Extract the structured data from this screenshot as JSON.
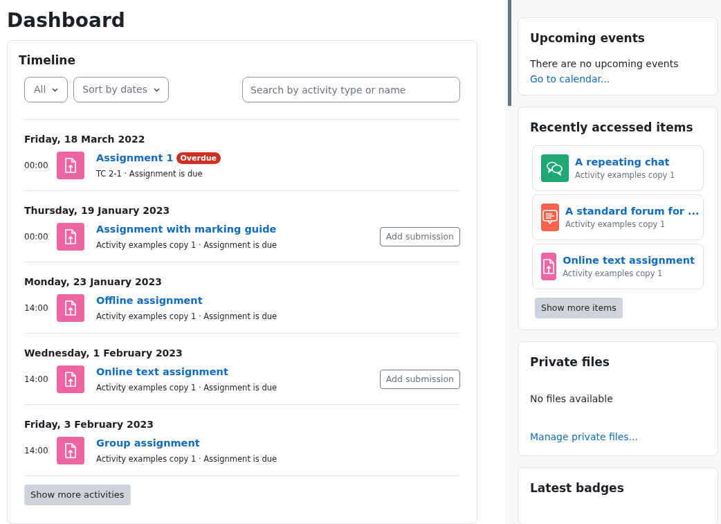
{
  "page_title": "Dashboard",
  "timeline": {
    "title": "Timeline",
    "filter": "All",
    "sort": "Sort by dates",
    "search": {
      "placeholder": "Search by activity type or name"
    },
    "days": [
      {
        "date": "Friday, 18 March 2022",
        "events": [
          {
            "time": "00:00",
            "name": "Assignment 1",
            "badge": "Overdue",
            "details": "TC 2-1 · Assignment is due"
          }
        ]
      },
      {
        "date": "Thursday, 19 January 2023",
        "events": [
          {
            "time": "00:00",
            "name": "Assignment with marking guide",
            "details": "Activity examples copy 1 · Assignment is due",
            "action": "Add submission"
          }
        ]
      },
      {
        "date": "Monday, 23 January 2023",
        "events": [
          {
            "time": "14:00",
            "name": "Offline assignment",
            "details": "Activity examples copy 1 · Assignment is due"
          }
        ]
      },
      {
        "date": "Wednesday, 1 February 2023",
        "events": [
          {
            "time": "14:00",
            "name": "Online text assignment",
            "details": "Activity examples copy 1 · Assignment is due",
            "action": "Add submission"
          }
        ]
      },
      {
        "date": "Friday, 3 February 2023",
        "events": [
          {
            "time": "14:00",
            "name": "Group assignment",
            "details": "Activity examples copy 1 · Assignment is due"
          }
        ]
      }
    ],
    "more_button": "Show more activities"
  },
  "upcoming_events": {
    "title": "Upcoming events",
    "message": "There are no upcoming events",
    "link": "Go to calendar..."
  },
  "recent_items": {
    "title": "Recently accessed items",
    "items": [
      {
        "kind": "chat",
        "name": "A repeating chat",
        "course": "Activity examples copy 1"
      },
      {
        "kind": "forum",
        "name": "A standard forum for ...",
        "course": "Activity examples copy 1"
      },
      {
        "kind": "assignment",
        "name": "Online text assignment",
        "course": "Activity examples copy 1"
      }
    ],
    "more_button": "Show more items"
  },
  "private_files": {
    "title": "Private files",
    "message": "No files available",
    "link": "Manage private files..."
  },
  "latest_badges": {
    "title": "Latest badges"
  }
}
